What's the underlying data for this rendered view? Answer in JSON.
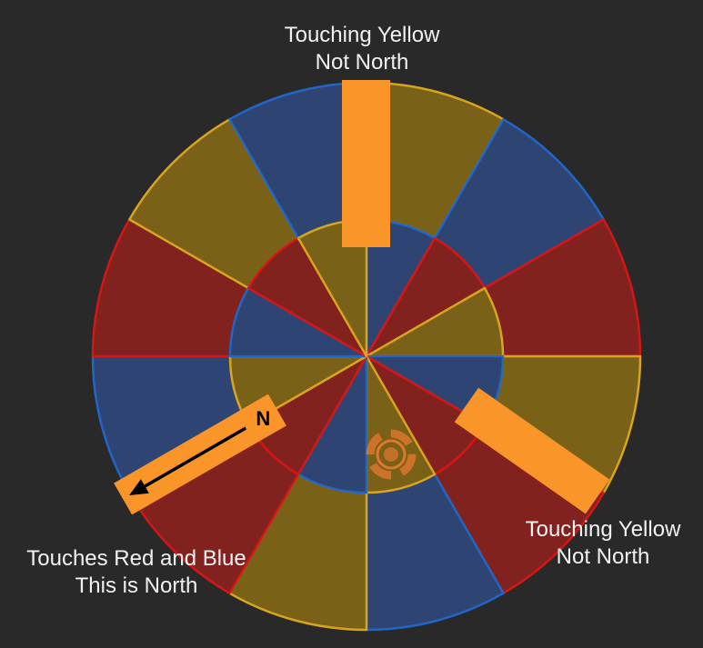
{
  "labels": {
    "top": {
      "line1": "Touching Yellow",
      "line2": "Not North"
    },
    "right": {
      "line1": "Touching Yellow",
      "line2": "Not North"
    },
    "bottom_left": {
      "line1": "Touches Red and Blue",
      "line2": "This is North"
    }
  },
  "marker_letter": "N",
  "colors": {
    "background": "#292929",
    "red_fill": "#82221f",
    "red_stroke": "#d51616",
    "blue_fill": "#2e4573",
    "blue_stroke": "#2166c7",
    "yellow_fill": "#7a6118",
    "yellow_stroke": "#d7a520",
    "bar": "#fa952a",
    "ring_center": "#ec7a31"
  },
  "outer_ring": [
    "yellow",
    "blue",
    "red",
    "yellow",
    "red",
    "blue",
    "yellow",
    "red",
    "blue",
    "red",
    "yellow",
    "blue"
  ],
  "inner_ring": [
    "blue",
    "red",
    "yellow",
    "blue",
    "red",
    "yellow",
    "blue",
    "red",
    "yellow",
    "blue",
    "red",
    "yellow"
  ]
}
